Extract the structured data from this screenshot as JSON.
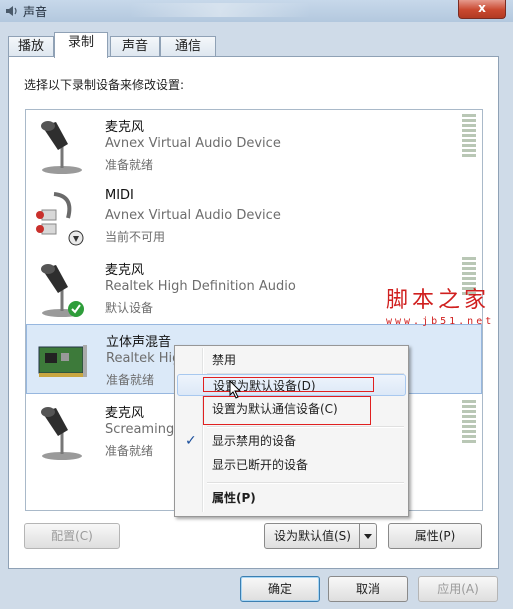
{
  "window": {
    "title": "声音",
    "close_label": "x"
  },
  "tabs": [
    {
      "label": "播放"
    },
    {
      "label": "录制"
    },
    {
      "label": "声音"
    },
    {
      "label": "通信"
    }
  ],
  "instruction": "选择以下录制设备来修改设置:",
  "devices": [
    {
      "name": "麦克风",
      "description": "Avnex Virtual Audio Device",
      "status": "准备就绪",
      "icon": "microphone-icon"
    },
    {
      "name": "MIDI",
      "description": "Avnex Virtual Audio Device",
      "status": "当前不可用",
      "icon": "midi-cable-icon"
    },
    {
      "name": "麦克风",
      "description": "Realtek High Definition Audio",
      "status": "默认设备",
      "icon": "microphone-default-icon"
    },
    {
      "name": "立体声混音",
      "description": "Realtek High",
      "status": "准备就绪",
      "icon": "sound-card-icon"
    },
    {
      "name": "麦克风",
      "description": "Screaming B",
      "status": "准备就绪",
      "icon": "microphone-icon"
    }
  ],
  "context_menu": {
    "items": [
      {
        "label": "禁用"
      },
      {
        "label": "设置为默认设备(D)"
      },
      {
        "label": "设置为默认通信设备(C)"
      },
      {
        "label": "显示禁用的设备",
        "checked": true
      },
      {
        "label": "显示已断开的设备"
      },
      {
        "label": "属性(P)"
      }
    ]
  },
  "buttons": {
    "configure": "配置(C)",
    "set_default": "设为默认值(S)",
    "properties": "属性(P)",
    "ok": "确定",
    "cancel": "取消",
    "apply": "应用(A)"
  },
  "watermark": {
    "main": "脚本之家",
    "sub": "www.jb51.net"
  },
  "colors": {
    "highlight": "#dbe9f8",
    "annotation_red": "#e02020",
    "watermark_red": "#d0201f"
  }
}
